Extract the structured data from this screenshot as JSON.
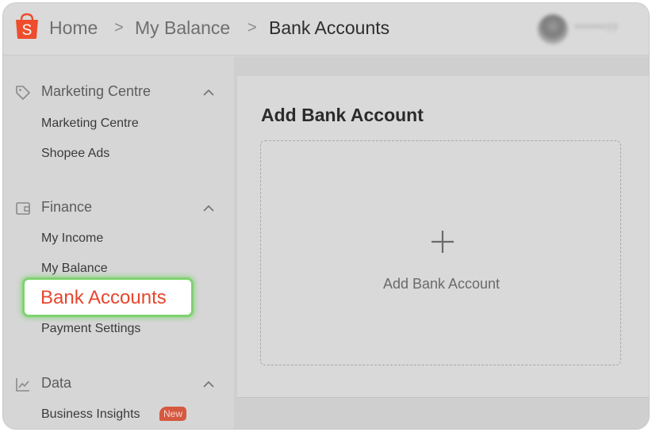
{
  "header": {
    "breadcrumbs": [
      "Home",
      "My Balance",
      "Bank Accounts"
    ],
    "separator": ">",
    "user_name": "********77",
    "logo_letter": "S",
    "brand_color": "#ee4d2d"
  },
  "sidebar": {
    "sections": [
      {
        "title": "Marketing Centre",
        "icon": "tag-icon",
        "items": [
          {
            "label": "Marketing Centre"
          },
          {
            "label": "Shopee Ads"
          }
        ]
      },
      {
        "title": "Finance",
        "icon": "wallet-icon",
        "items": [
          {
            "label": "My Income"
          },
          {
            "label": "My Balance"
          },
          {
            "label": "Bank Accounts",
            "active": true
          },
          {
            "label": "Payment Settings"
          }
        ]
      },
      {
        "title": "Data",
        "icon": "chart-icon",
        "items": [
          {
            "label": "Business Insights",
            "badge": "New"
          }
        ]
      }
    ],
    "highlight_color": "#7ed36f",
    "active_color": "#e4472d"
  },
  "main": {
    "title": "Add Bank Account",
    "add_box_label": "Add Bank Account",
    "add_icon": "plus-icon"
  }
}
